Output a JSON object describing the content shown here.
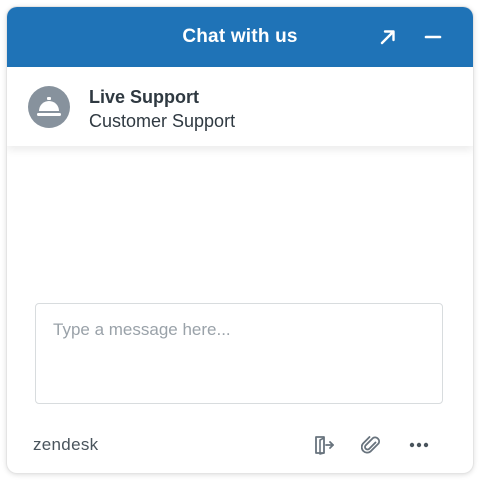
{
  "header": {
    "title": "Chat with us",
    "popout_icon": "arrow-up-right-icon",
    "minimize_icon": "minus-icon",
    "background_color": "#1f73b7"
  },
  "agent": {
    "name": "Live Support",
    "title": "Customer Support",
    "avatar_icon": "concierge-bell-icon",
    "avatar_color": "#87929d"
  },
  "composer": {
    "placeholder": "Type a message here..."
  },
  "footer": {
    "brand": "zendesk",
    "end_chat_icon": "exit-door-icon",
    "attach_icon": "paperclip-icon",
    "more_icon": "more-dots-icon"
  }
}
